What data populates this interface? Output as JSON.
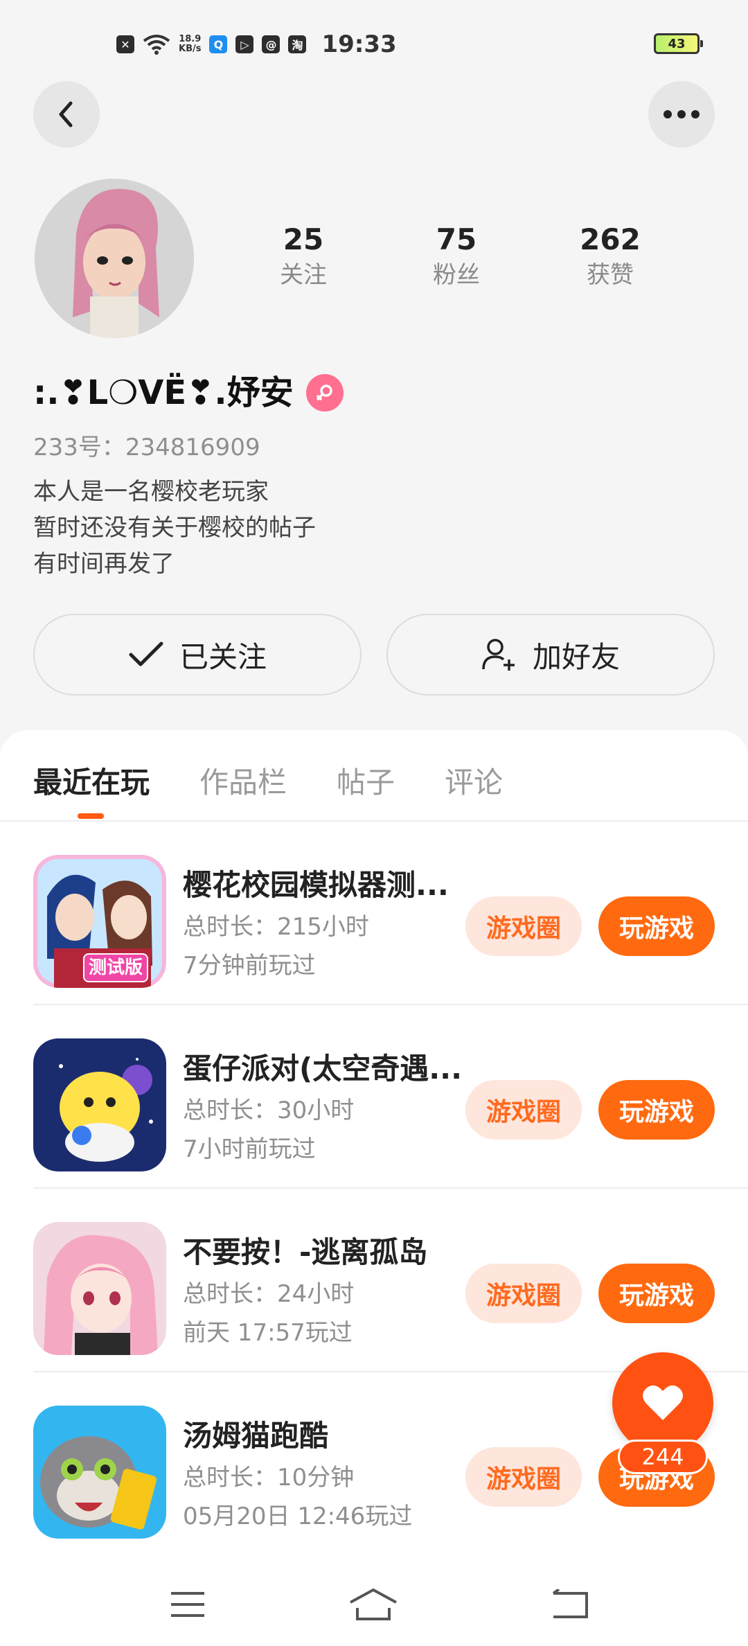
{
  "status_bar": {
    "network_speed_value": "18.9",
    "network_speed_unit": "KB/s",
    "time": "19:33",
    "battery": "43",
    "app_icon_labels": [
      "淘"
    ]
  },
  "profile": {
    "nickname": ":.❣L❍VË❣.妤安",
    "uid_text": "233号：234816909",
    "bio_lines": [
      "本人是一名樱校老玩家",
      "暂时还没有关于樱校的帖子",
      "有时间再发了"
    ],
    "stats": [
      {
        "value": "25",
        "label": "关注"
      },
      {
        "value": "75",
        "label": "粉丝"
      },
      {
        "value": "262",
        "label": "获赞"
      }
    ],
    "follow_button": "已关注",
    "add_friend_button": "加好友"
  },
  "tabs": [
    "最近在玩",
    "作品栏",
    "帖子",
    "评论"
  ],
  "active_tab": "最近在玩",
  "games": [
    {
      "title": "樱花校园模拟器测...",
      "total_time": "总时长：215小时",
      "last_played": "7分钟前玩过",
      "circle_button": "游戏圈",
      "play_button": "玩游戏",
      "icon": "sakura-school-test-icon",
      "icon_badge": "测试版"
    },
    {
      "title": "蛋仔派对(太空奇遇...",
      "total_time": "总时长：30小时",
      "last_played": "7小时前玩过",
      "circle_button": "游戏圈",
      "play_button": "玩游戏",
      "icon": "eggy-party-icon"
    },
    {
      "title": "不要按！-逃离孤岛",
      "total_time": "总时长：24小时",
      "last_played": "前天 17:57玩过",
      "circle_button": "游戏圈",
      "play_button": "玩游戏",
      "icon": "anime-girl-game-icon"
    },
    {
      "title": "汤姆猫跑酷",
      "total_time": "总时长：10分钟",
      "last_played": "05月20日 12:46玩过",
      "circle_button": "游戏圈",
      "play_button": "玩游戏",
      "icon": "talking-tom-run-icon"
    }
  ],
  "like_fab": {
    "count": "244"
  },
  "colors": {
    "accent": "#ff6a10",
    "accent_light": "#fee6dc",
    "background": "#f5f5f5",
    "female_badge": "#ff6f8f"
  }
}
